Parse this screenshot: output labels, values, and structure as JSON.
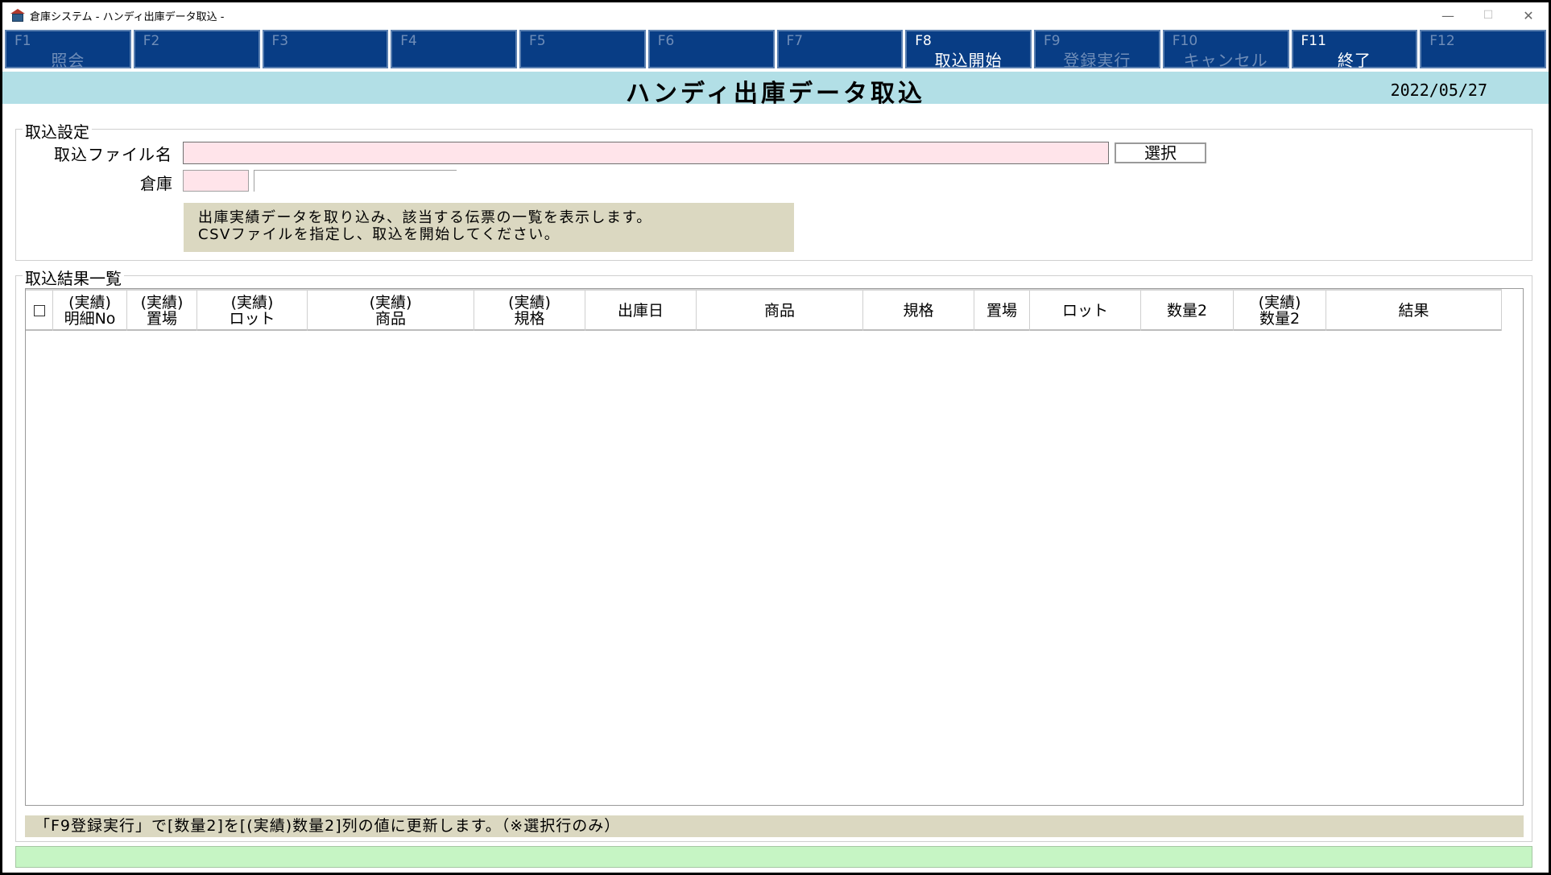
{
  "window": {
    "title": "倉庫システム - ハンディ出庫データ取込 -",
    "minimize": "—",
    "maximize": "☐",
    "close": "✕"
  },
  "fkeys": [
    {
      "key": "F1",
      "label": "照会",
      "active": false
    },
    {
      "key": "F2",
      "label": "",
      "active": false
    },
    {
      "key": "F3",
      "label": "",
      "active": false
    },
    {
      "key": "F4",
      "label": "",
      "active": false
    },
    {
      "key": "F5",
      "label": "",
      "active": false
    },
    {
      "key": "F6",
      "label": "",
      "active": false
    },
    {
      "key": "F7",
      "label": "",
      "active": false
    },
    {
      "key": "F8",
      "label": "取込開始",
      "active": true
    },
    {
      "key": "F9",
      "label": "登録実行",
      "active": false
    },
    {
      "key": "F10",
      "label": "キャンセル",
      "active": false
    },
    {
      "key": "F11",
      "label": "終了",
      "active": true
    },
    {
      "key": "F12",
      "label": "",
      "active": false
    }
  ],
  "header": {
    "title": "ハンディ出庫データ取込",
    "date": "2022/05/27"
  },
  "settings": {
    "legend": "取込設定",
    "file_label": "取込ファイル名",
    "file_value": "",
    "select_button": "選択",
    "warehouse_label": "倉庫",
    "warehouse_code": "",
    "warehouse_name": "",
    "info_lines": [
      "出庫実績データを取り込み、該当する伝票の一覧を表示します。",
      "CSVファイルを指定し、取込を開始してください。"
    ]
  },
  "results": {
    "legend": "取込結果一覧",
    "columns": [
      {
        "line1": "",
        "line2": "",
        "checkbox": true
      },
      {
        "line1": "(実績)",
        "line2": "明細No"
      },
      {
        "line1": "(実績)",
        "line2": "置場"
      },
      {
        "line1": "(実績)",
        "line2": "ロット"
      },
      {
        "line1": "(実績)",
        "line2": "商品"
      },
      {
        "line1": "(実績)",
        "line2": "規格"
      },
      {
        "line1": "出庫日",
        "line2": ""
      },
      {
        "line1": "商品",
        "line2": ""
      },
      {
        "line1": "規格",
        "line2": ""
      },
      {
        "line1": "置場",
        "line2": ""
      },
      {
        "line1": "ロット",
        "line2": ""
      },
      {
        "line1": "数量2",
        "line2": ""
      },
      {
        "line1": "(実績)",
        "line2": "数量2"
      },
      {
        "line1": "結果",
        "line2": ""
      }
    ],
    "rows": []
  },
  "note": "「F9登録実行」で[数量2]を[(実績)数量2]列の値に更新します。（※選択行のみ）",
  "status": ""
}
